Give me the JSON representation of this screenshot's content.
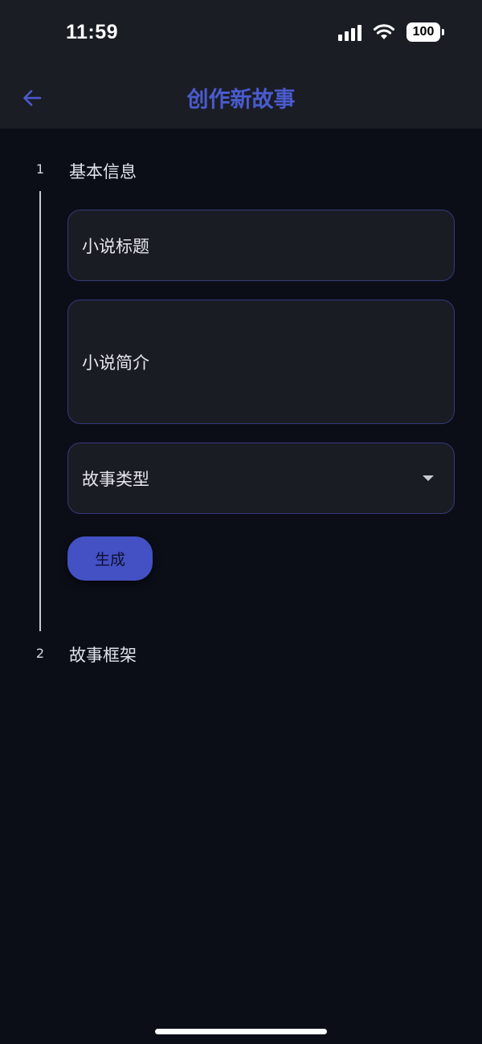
{
  "status_bar": {
    "time": "11:59",
    "battery": "100"
  },
  "app_bar": {
    "title": "创作新故事",
    "back_icon": "arrow-left-icon"
  },
  "stepper": {
    "steps": [
      {
        "number": "1",
        "title": "基本信息"
      },
      {
        "number": "2",
        "title": "故事框架"
      }
    ]
  },
  "form": {
    "title_field": {
      "label": "小说标题",
      "value": ""
    },
    "intro_field": {
      "label": "小说简介",
      "value": ""
    },
    "genre_select": {
      "label": "故事类型",
      "selected": "",
      "icon": "dropdown-triangle-icon"
    },
    "generate_button": "生成"
  },
  "colors": {
    "background": "#0b0e17",
    "app_bar": "#1b1d25",
    "accent": "#4a5bcf",
    "button": "#4351c4",
    "field_bg": "#1a1c24",
    "field_border": "#323a78"
  }
}
